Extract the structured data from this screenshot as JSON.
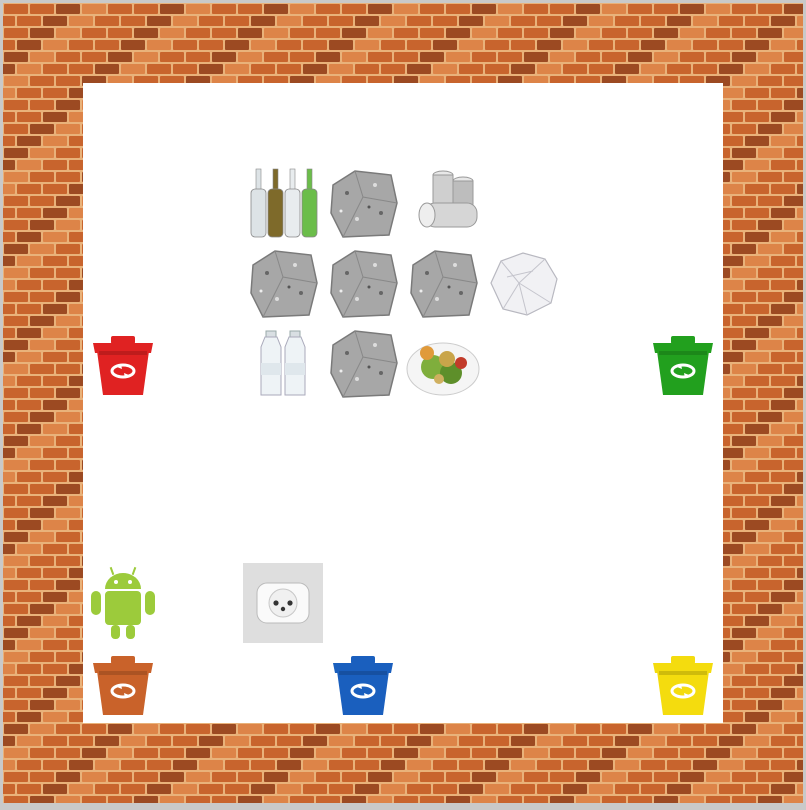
{
  "game": {
    "title": "",
    "grid": {
      "cols": 10,
      "rows": 10,
      "wall_thickness_cells": 1
    }
  },
  "colors": {
    "brick": "#c8642d",
    "brick_light": "#dd8448",
    "brick_dark": "#9c4a22",
    "mortar": "#e9b27a",
    "floor": "#ffffff",
    "bin_red": "#e02222",
    "bin_green": "#22a01e",
    "bin_orange": "#c9622a",
    "bin_blue": "#1a5fbe",
    "bin_yellow": "#f4dc0e",
    "robot": "#9ccb3b"
  },
  "tiles": [
    {
      "id": "glass-bottles",
      "icon": "glass-bottles-icon",
      "col": 3,
      "row": 2
    },
    {
      "id": "stone-1",
      "icon": "stone-icon",
      "col": 4,
      "row": 2
    },
    {
      "id": "metal-cans",
      "icon": "metal-cans-icon",
      "col": 5,
      "row": 2
    },
    {
      "id": "stone-2",
      "icon": "stone-icon",
      "col": 3,
      "row": 3
    },
    {
      "id": "stone-3",
      "icon": "stone-icon",
      "col": 4,
      "row": 3
    },
    {
      "id": "stone-4",
      "icon": "stone-icon",
      "col": 5,
      "row": 3
    },
    {
      "id": "crumpled-paper",
      "icon": "crumpled-paper-icon",
      "col": 6,
      "row": 3
    },
    {
      "id": "red-bin",
      "icon": "red-recycling-bin-icon",
      "col": 1,
      "row": 4,
      "color": "#e02222"
    },
    {
      "id": "plastic-bottles",
      "icon": "plastic-bottles-icon",
      "col": 3,
      "row": 4
    },
    {
      "id": "stone-5",
      "icon": "stone-icon",
      "col": 4,
      "row": 4
    },
    {
      "id": "food-waste",
      "icon": "food-waste-icon",
      "col": 5,
      "row": 4
    },
    {
      "id": "green-bin",
      "icon": "green-recycling-bin-icon",
      "col": 8,
      "row": 4,
      "color": "#22a01e"
    },
    {
      "id": "robot",
      "icon": "android-robot-icon",
      "col": 1,
      "row": 7
    },
    {
      "id": "power-outlet",
      "icon": "power-outlet-icon",
      "col": 3,
      "row": 7
    },
    {
      "id": "orange-bin",
      "icon": "orange-recycling-bin-icon",
      "col": 1,
      "row": 8,
      "color": "#c9622a"
    },
    {
      "id": "blue-bin",
      "icon": "blue-recycling-bin-icon",
      "col": 4,
      "row": 8,
      "color": "#1a5fbe"
    },
    {
      "id": "yellow-bin",
      "icon": "yellow-recycling-bin-icon",
      "col": 8,
      "row": 8,
      "color": "#f4dc0e"
    }
  ]
}
